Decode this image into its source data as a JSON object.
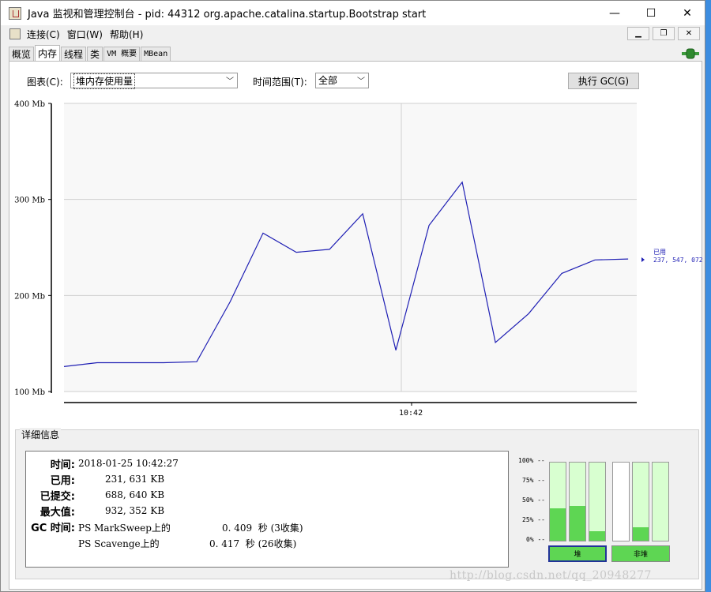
{
  "window": {
    "title": "Java 监视和管理控制台 - pid: 44312 org.apache.catalina.startup.Bootstrap start",
    "minimize": "—",
    "maximize": "☐",
    "close": "✕"
  },
  "menu": {
    "items": [
      "连接(C)",
      "窗口(W)",
      "帮助(H)"
    ],
    "mdi_minimize": "▁",
    "mdi_restore": "❐",
    "mdi_close": "✕"
  },
  "tabs": [
    "概览",
    "内存",
    "线程",
    "类",
    "VM 概要",
    "MBean"
  ],
  "active_tab": "内存",
  "controls": {
    "chart_label": "图表(C):",
    "chart_value": "堆内存使用量",
    "range_label": "时间范围(T):",
    "range_value": "全部",
    "gc_button": "执行 GC(G)"
  },
  "chart_data": {
    "type": "line",
    "y_ticks": [
      "400 Mb",
      "300 Mb",
      "200 Mb",
      "100 Mb"
    ],
    "ylim": [
      100,
      400
    ],
    "x_tick": "10:42",
    "values": [
      126,
      130,
      130,
      130,
      131,
      193,
      265,
      245,
      248,
      285,
      143,
      273,
      318,
      151,
      181,
      223,
      237,
      238
    ],
    "series_label": "已用",
    "series_value": "237, 547, 072",
    "line_color": "#1f1fb4",
    "grid": true
  },
  "details": {
    "title": "详细信息",
    "time_label": "时间:",
    "time_value": "2018-01-25 10:42:27",
    "used_label": "已用:",
    "used_value": "231, 631 KB",
    "committed_label": "已提交:",
    "committed_value": "688, 640 KB",
    "max_label": "最大值:",
    "max_value": "932, 352 KB",
    "gc_label": "GC 时间:",
    "gc_rows": [
      {
        "name": "PS MarkSweep上的",
        "value": "0. 409  秒 (3收集)"
      },
      {
        "name": "PS Scavenge上的",
        "value": "0. 417  秒 (26收集)"
      }
    ]
  },
  "bars": {
    "percent_labels": [
      "100% --",
      "75% --",
      "50% --",
      "25% --",
      "0% --"
    ],
    "heap": [
      0.41,
      0.44,
      0.12
    ],
    "nonheap": [
      0,
      0.17,
      0
    ],
    "heap_label": "堆",
    "nonheap_label": "非堆",
    "fill_color": "#5ed653"
  },
  "watermark": "http://blog.csdn.net/qq_20948277"
}
